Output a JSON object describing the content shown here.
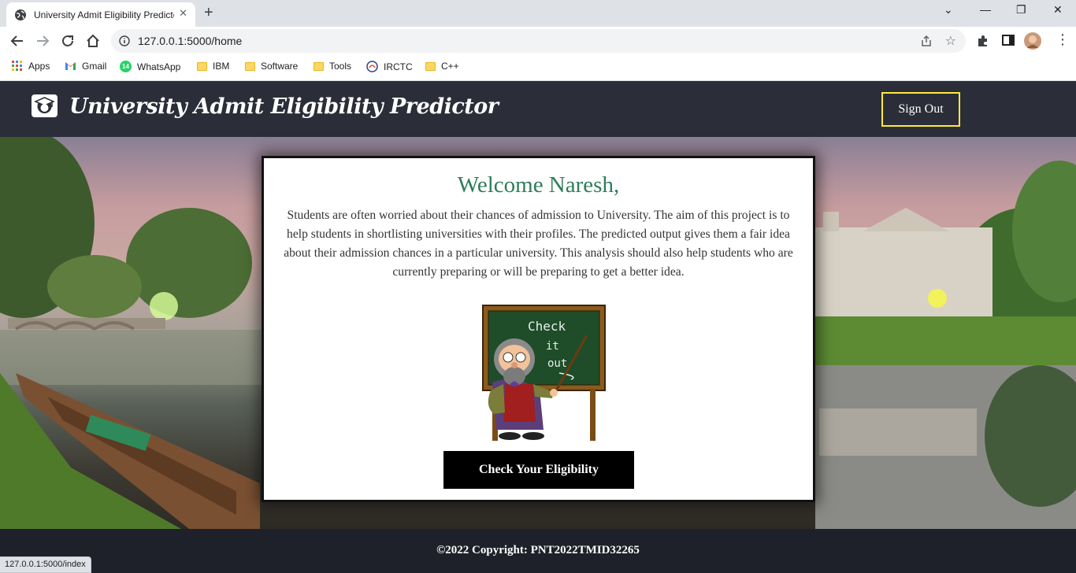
{
  "browser": {
    "tab_title": "University Admit Eligibility Predictor",
    "url": "127.0.0.1:5000/home",
    "status_url": "127.0.0.1:5000/index",
    "bookmarks": [
      {
        "label": "Apps",
        "icon": "apps-grid-icon"
      },
      {
        "label": "Gmail",
        "icon": "gmail-icon"
      },
      {
        "label": "WhatsApp",
        "icon": "whatsapp-icon",
        "badge": "14"
      },
      {
        "label": "IBM",
        "icon": "folder-icon"
      },
      {
        "label": "Software",
        "icon": "folder-icon"
      },
      {
        "label": "Tools",
        "icon": "folder-icon"
      },
      {
        "label": "IRCTC",
        "icon": "irctc-icon"
      },
      {
        "label": "C++",
        "icon": "folder-icon"
      }
    ]
  },
  "header": {
    "title": "University Admit Eligibility Predictor",
    "signout_label": "Sign Out"
  },
  "card": {
    "welcome": "Welcome Naresh,",
    "description": "Students are often worried about their chances of admission to University. The aim of this project is to help students in shortlisting universities with their profiles. The predicted output gives them a fair idea about their admission chances in a particular university. This analysis should also help students who are currently preparing or will be preparing to get a better idea.",
    "chalkboard_text": [
      "Check",
      "it",
      "out"
    ],
    "button_label": "Check Your Eligibility"
  },
  "footer": {
    "copyright": "©2022 Copyright: PNT2022TMID32265"
  },
  "colors": {
    "header_bg": "#2b2e38",
    "signout_border": "#ffeb3b",
    "welcome_text": "#2e7d5b",
    "button_bg": "#000000"
  }
}
